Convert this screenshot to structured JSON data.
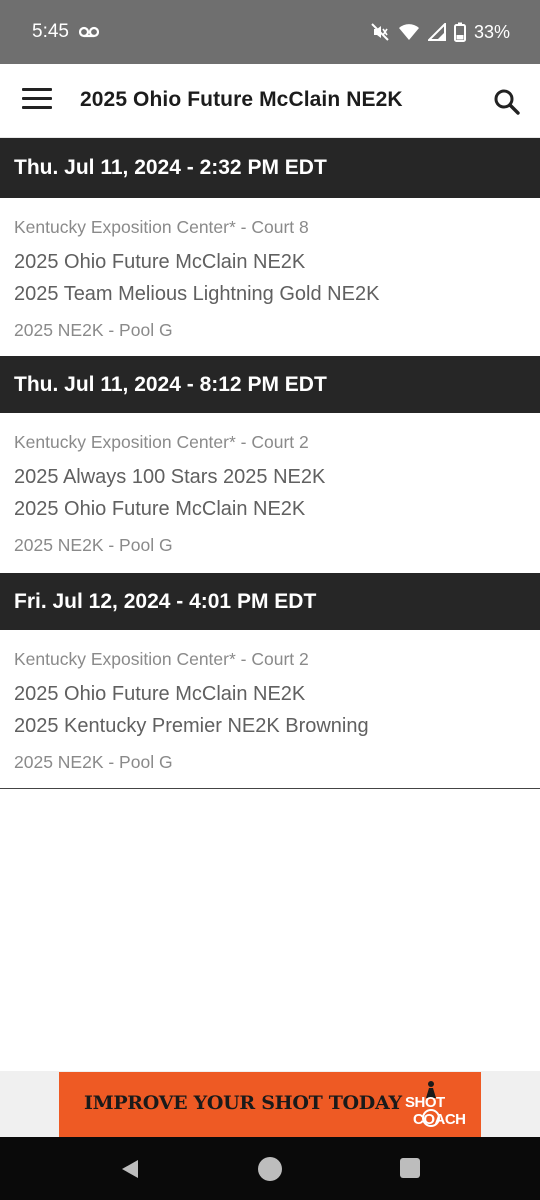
{
  "status_bar": {
    "time": "5:45",
    "battery_percent": "33%",
    "icons": [
      "voicemail-icon",
      "mute-icon",
      "wifi-icon",
      "signal-icon",
      "battery-icon"
    ]
  },
  "app_bar": {
    "title": "2025 Ohio Future McClain NE2K",
    "icons": [
      "menu-icon",
      "search-icon"
    ]
  },
  "schedule": [
    {
      "date": "Thu. Jul 11, 2024 - 2:32 PM EDT",
      "venue": "Kentucky Exposition Center* - Court 8",
      "team1": "2025 Ohio Future McClain NE2K",
      "team2": "2025 Team Melious Lightning Gold NE2K",
      "pool": "2025 NE2K - Pool G"
    },
    {
      "date": "Thu. Jul 11, 2024 - 8:12 PM EDT",
      "venue": "Kentucky Exposition Center* - Court 2",
      "team1": "2025 Always 100 Stars 2025 NE2K",
      "team2": "2025 Ohio Future McClain NE2K",
      "pool": "2025 NE2K - Pool G"
    },
    {
      "date": "Fri. Jul 12, 2024 - 4:01 PM EDT",
      "venue": "Kentucky Exposition Center* - Court 2",
      "team1": "2025 Ohio Future McClain NE2K",
      "team2": "2025 Kentucky Premier NE2K Browning",
      "pool": "2025 NE2K - Pool G"
    }
  ],
  "ad": {
    "text": "IMPROVE YOUR SHOT TODAY",
    "logo_line1": "SHOT",
    "logo_line2": "COACH",
    "background": "#ee5a24"
  },
  "nav_bar": {
    "icons": [
      "back-icon",
      "home-icon",
      "recents-icon"
    ]
  }
}
